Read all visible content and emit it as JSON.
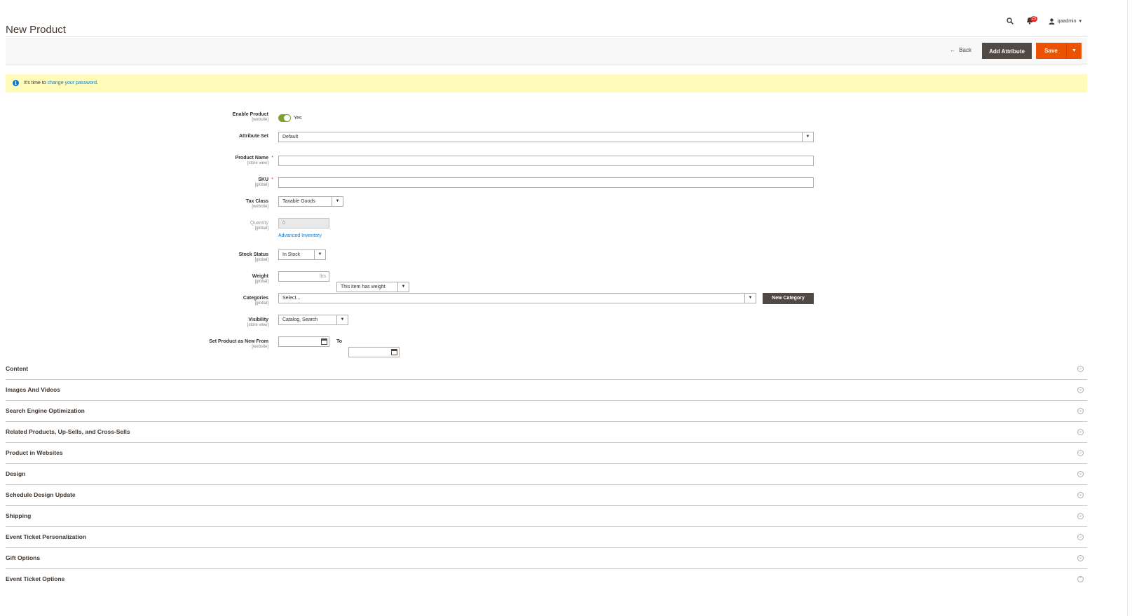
{
  "header": {
    "title": "New Product",
    "notification_count": "25",
    "username": "qaadmin"
  },
  "actions": {
    "back_label": "Back",
    "add_attribute_label": "Add Attribute",
    "save_label": "Save"
  },
  "notice": {
    "prefix": "It's time to ",
    "link": "change your password",
    "suffix": "."
  },
  "form": {
    "enable_product": {
      "label": "Enable Product",
      "scope": "[website]",
      "value": "Yes"
    },
    "attribute_set": {
      "label": "Attribute Set",
      "value": "Default"
    },
    "product_name": {
      "label": "Product Name",
      "scope": "[store view]",
      "value": ""
    },
    "sku": {
      "label": "SKU",
      "scope": "[global]",
      "value": ""
    },
    "tax_class": {
      "label": "Tax Class",
      "scope": "[website]",
      "value": "Taxable Goods"
    },
    "quantity": {
      "label": "Quantity",
      "scope": "[global]",
      "value": "0",
      "link": "Advanced Inventory"
    },
    "stock_status": {
      "label": "Stock Status",
      "scope": "[global]",
      "value": "In Stock"
    },
    "weight": {
      "label": "Weight",
      "scope": "[global]",
      "unit": "lbs",
      "value": "",
      "has_weight": "This item has weight"
    },
    "categories": {
      "label": "Categories",
      "scope": "[global]",
      "placeholder": "Select...",
      "new_button": "New Category"
    },
    "visibility": {
      "label": "Visibility",
      "scope": "[store view]",
      "value": "Catalog, Search"
    },
    "new_from": {
      "label": "Set Product as New From",
      "scope": "[website]",
      "to_label": "To",
      "from_value": "",
      "to_value": ""
    }
  },
  "sections": [
    "Content",
    "Images And Videos",
    "Search Engine Optimization",
    "Related Products, Up-Sells, and Cross-Sells",
    "Product in Websites",
    "Design",
    "Schedule Design Update",
    "Shipping",
    "Event Ticket Personalization",
    "Gift Options",
    "Event Ticket Options"
  ],
  "colors": {
    "primary": "#eb5202",
    "secondary": "#514943",
    "notice_bg": "#fffbbb",
    "link": "#007bdb",
    "toggle_on": "#79a22e"
  }
}
